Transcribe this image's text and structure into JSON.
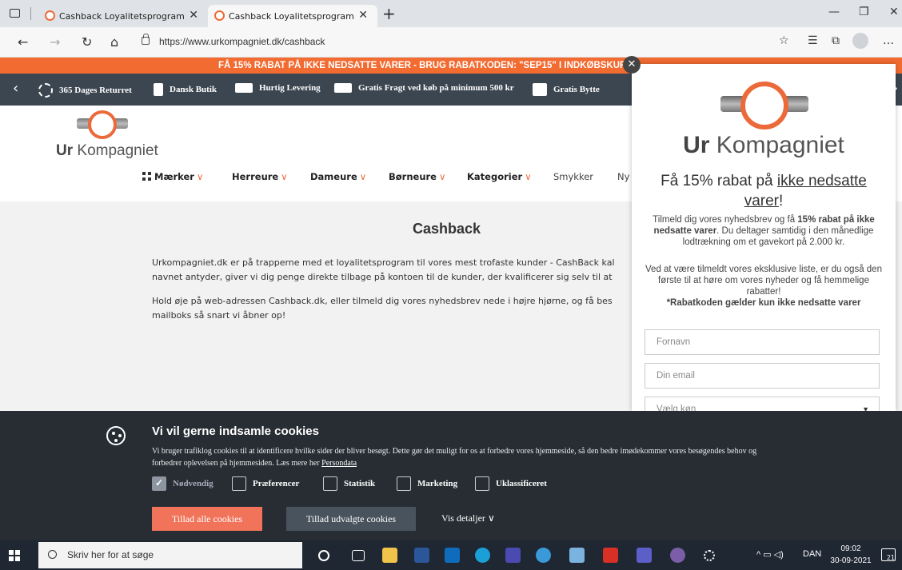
{
  "browser": {
    "tabs": [
      {
        "title": "Cashback Loyalitetsprogram",
        "active": false
      },
      {
        "title": "Cashback Loyalitetsprogram",
        "active": true
      }
    ],
    "url": "https://www.urkompagniet.dk/cashback",
    "window_controls": {
      "minimize": "—",
      "maximize": "❐",
      "close": "✕"
    }
  },
  "promo_bar": {
    "text": "FÅ 15% RABAT PÅ IKKE NEDSATTE VARER - BRUG RABATKODEN: \"SEP15\" I INDKØBSKURV",
    "color": "#f26b31"
  },
  "usp_bar": {
    "items": [
      {
        "label": "365 Dages Returret",
        "icon": "return-icon"
      },
      {
        "label": "Dansk Butik",
        "icon": "document-icon"
      },
      {
        "label": "Hurtig Levering",
        "icon": "truck-icon"
      },
      {
        "label": "Gratis Fragt ved køb på minimum 500 kr",
        "icon": "delivery-van-icon"
      },
      {
        "label": "Gratis Bytte",
        "icon": "exchange-icon"
      }
    ]
  },
  "site": {
    "logo_text_bold": "Ur",
    "logo_text": " Kompagniet",
    "menu": [
      {
        "label": "Mærker",
        "has_dropdown": true
      },
      {
        "label": "Herreure",
        "has_dropdown": true
      },
      {
        "label": "Dameure",
        "has_dropdown": true
      },
      {
        "label": "Børneure",
        "has_dropdown": true
      },
      {
        "label": "Kategorier",
        "has_dropdown": true
      },
      {
        "label": "Smykker",
        "has_dropdown": false
      },
      {
        "label": "Ny",
        "has_dropdown": false
      }
    ]
  },
  "page": {
    "title": "Cashback",
    "paragraph1_line1": "Urkompagniet.dk er på trapperne med et loyalitetsprogram til vores mest trofaste kunder - CashBack kal",
    "paragraph1_line2": "navnet antyder, giver vi dig penge direkte tilbage på kontoen til de kunder, der kvalificerer sig selv til at",
    "paragraph2_line1": "Hold øje på web-adressen Cashback.dk, eller tilmeld dig vores nyhedsbrev nede i højre hjørne, og få bes",
    "paragraph2_line2": "mailboks så snart vi åbner op!"
  },
  "popup": {
    "close": "✕",
    "brand_bold": "Ur",
    "brand": " Kompagniet",
    "heading_pre": "Få 15% rabat på ",
    "heading_link": "ikke nedsatte varer",
    "heading_post": "!",
    "body1_pre": "Tilmeld dig vores nyhedsbrev og få ",
    "body1_bold": "15% rabat på ikke nedsatte varer",
    "body1_post": ". Du deltager samtidig i den månedlige lodtrækning om et gavekort på 2.000 kr.",
    "body2": "Ved at være tilmeldt vores eksklusive liste, er du også den første til at høre om vores nyheder og få hemmelige rabatter!",
    "body2_bold": "*Rabatkoden gælder kun ikke nedsatte varer",
    "field_firstname": "Fornavn",
    "field_email": "Din email",
    "field_gender": "Vælg køn"
  },
  "cookie_banner": {
    "title": "Vi vil gerne indsamle cookies",
    "description": "Vi bruger trafiklog cookies til at identificere hvilke sider der bliver besøgt. Dette gør det muligt for os at forbedre vores hjemmeside, så den bedre imødekommer vores besøgendes behov og forbedrer oplevelsen på hjemmesiden. Læs mere her ",
    "link": "Persondata",
    "checkboxes": [
      {
        "label": "Nødvendig",
        "checked": true
      },
      {
        "label": "Præferencer",
        "checked": false
      },
      {
        "label": "Statistik",
        "checked": false
      },
      {
        "label": "Marketing",
        "checked": false
      },
      {
        "label": "Uklassificeret",
        "checked": false
      }
    ],
    "btn_allow_all": "Tillad alle cookies",
    "btn_allow_selected": "Tillad udvalgte cookies",
    "btn_details": "Vis detaljer",
    "accent_color": "#f0735a"
  },
  "taskbar": {
    "search_placeholder": "Skriv her for at søge",
    "language": "DAN",
    "time": "09:02",
    "date": "30-09-2021",
    "notification_count": "21"
  }
}
